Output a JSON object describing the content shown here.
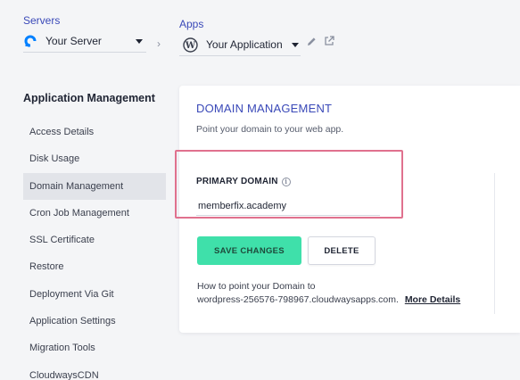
{
  "header": {
    "servers": {
      "label": "Servers",
      "value": "Your Server",
      "icon": "digitalocean-icon"
    },
    "apps": {
      "label": "Apps",
      "value": "Your Application",
      "icon": "wordpress-icon"
    }
  },
  "sidebar": {
    "title": "Application Management",
    "items": [
      {
        "label": "Access Details"
      },
      {
        "label": "Disk Usage"
      },
      {
        "label": "Domain Management",
        "active": true
      },
      {
        "label": "Cron Job Management"
      },
      {
        "label": "SSL Certificate"
      },
      {
        "label": "Restore"
      },
      {
        "label": "Deployment Via Git"
      },
      {
        "label": "Application Settings"
      },
      {
        "label": "Migration Tools"
      },
      {
        "label": "CloudwaysCDN"
      }
    ]
  },
  "card": {
    "title": "DOMAIN MANAGEMENT",
    "subtitle": "Point your domain to your web app.",
    "primary_domain_label": "PRIMARY DOMAIN",
    "primary_domain_value": "memberfix.academy",
    "save_label": "SAVE CHANGES",
    "delete_label": "DELETE",
    "help_text": "How to point your Domain to",
    "help_host": "wordpress-256576-798967.cloudwaysapps.com.",
    "help_link": "More Details"
  },
  "colors": {
    "accent": "#3a49b8",
    "save_button": "#3fe0aa",
    "highlight_border": "#e0718e"
  }
}
